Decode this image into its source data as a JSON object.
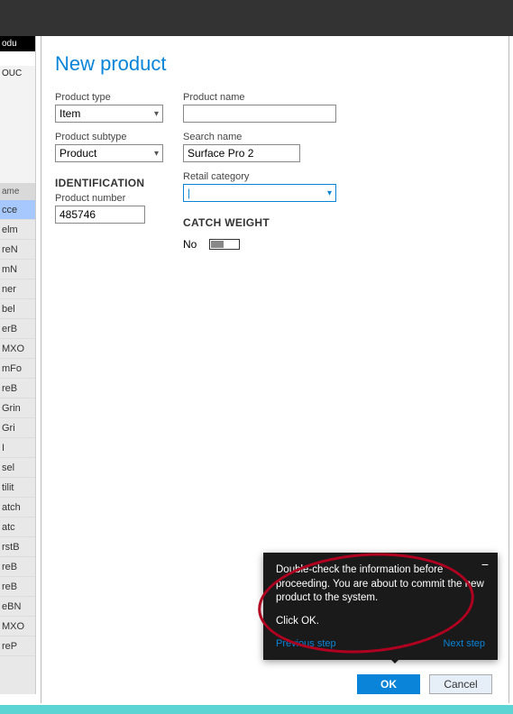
{
  "window": {
    "title": "New product"
  },
  "form": {
    "product_type": {
      "label": "Product type",
      "value": "Item"
    },
    "product_name": {
      "label": "Product name",
      "value": ""
    },
    "product_subtype": {
      "label": "Product subtype",
      "value": "Product"
    },
    "search_name": {
      "label": "Search name",
      "value": "Surface Pro 2"
    },
    "retail_category": {
      "label": "Retail category",
      "value": ""
    },
    "identification_header": "IDENTIFICATION",
    "product_number": {
      "label": "Product number",
      "value": "485746"
    },
    "catch_weight_header": "CATCH WEIGHT",
    "catch_weight_value": "No"
  },
  "buttons": {
    "ok": "OK",
    "cancel": "Cancel"
  },
  "tooltip": {
    "body": "Double-check the information before proceeding. You are about to commit the new product to the system.",
    "action": "Click OK.",
    "prev": "Previous step",
    "next": "Next step"
  },
  "background": {
    "tab": "odu",
    "header": "OUC",
    "col": "ame",
    "rows": [
      "cce",
      "elm",
      "reN",
      "mN",
      "ner",
      "bel",
      "erB",
      "MXO",
      "mFo",
      "reB",
      "Grin",
      "Gri",
      "I",
      "sel",
      "tilit",
      "atch",
      "atc",
      "rstB",
      "reB",
      "reB",
      "eBN",
      "MXO",
      "reP"
    ]
  }
}
